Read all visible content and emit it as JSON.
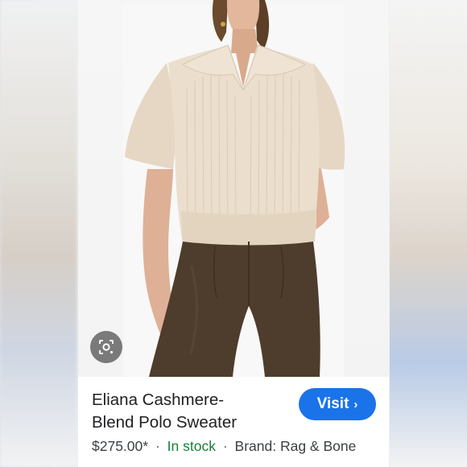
{
  "product": {
    "title_line1": "Eliana Cashmere-",
    "title_line2": "Blend Polo Sweater",
    "price": "$275.00*",
    "separator": "·",
    "stock": "In stock",
    "brand": "Brand: Rag & Bone"
  },
  "actions": {
    "visit_label": "Visit",
    "visit_icon": "chevron-right-icon",
    "lens_icon": "google-lens-icon"
  },
  "colors": {
    "visit_button": "#1a73e8",
    "in_stock": "#188038",
    "sweater": "#e9dccb",
    "pants": "#4e3c2d"
  }
}
